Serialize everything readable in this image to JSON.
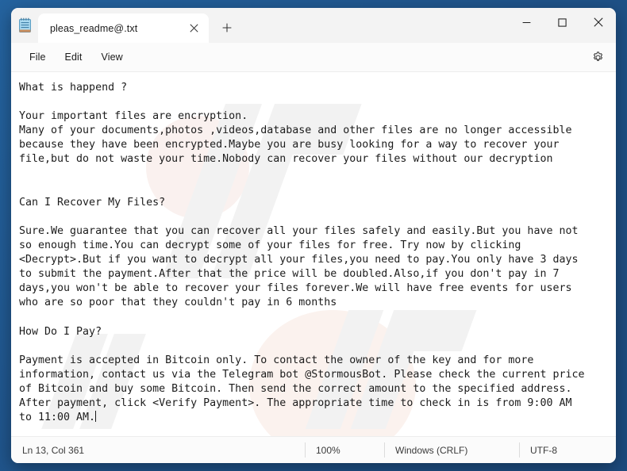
{
  "desktop": {
    "background_color": "#225891"
  },
  "window": {
    "app_icon": "notepad-icon",
    "controls": {
      "minimize": "—",
      "maximize": "□",
      "close": "✕"
    }
  },
  "tabs": [
    {
      "title": "pleas_readme@.txt",
      "close_label": "✕",
      "active": true
    }
  ],
  "new_tab": {
    "label": "+"
  },
  "menu": {
    "items": [
      {
        "label": "File"
      },
      {
        "label": "Edit"
      },
      {
        "label": "View"
      }
    ],
    "settings_icon": "gear-icon"
  },
  "editor": {
    "watermark_text": "",
    "content": "What is happend ?\n\nYour important files are encryption.\nMany of your documents,photos ,videos,database and other files are no longer accessible\nbecause they have been encrypted.Maybe you are busy looking for a way to recover your\nfile,but do not waste your time.Nobody can recover your files without our decryption\n\n\nCan I Recover My Files?\n\nSure.We guarantee that you can recover all your files safely and easily.But you have not\nso enough time.You can decrypt some of your files for free. Try now by clicking\n<Decrypt>.But if you want to decrypt all your files,you need to pay.You only have 3 days\nto submit the payment.After that the price will be doubled.Also,if you don't pay in 7\ndays,you won't be able to recover your files forever.We will have free events for users\nwho are so poor that they couldn't pay in 6 months\n\nHow Do I Pay?\n\nPayment is accepted in Bitcoin only. To contact the owner of the key and for more\ninformation, contact us via the Telegram bot @StormousBot. Please check the current price\nof Bitcoin and buy some Bitcoin. Then send the correct amount to the specified address.\nAfter payment, click <Verify Payment>. The appropriate time to check in is from 9:00 AM\nto 11:00 AM."
  },
  "statusbar": {
    "line_col": "Ln 13, Col 361",
    "zoom": "100%",
    "line_ending": "Windows (CRLF)",
    "encoding": "UTF-8"
  }
}
